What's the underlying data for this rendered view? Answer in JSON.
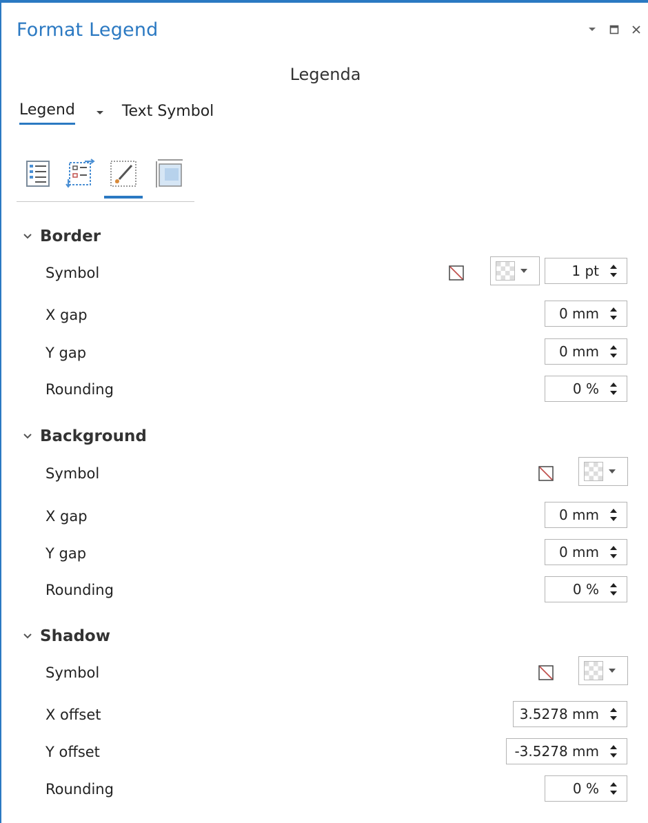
{
  "window": {
    "title": "Format Legend",
    "controls": [
      "chevron-down-icon",
      "maximize-icon",
      "close-icon"
    ]
  },
  "element_name": "Legenda",
  "tabs": [
    {
      "label": "Legend",
      "active": true
    },
    {
      "label": "Text Symbol",
      "active": false
    }
  ],
  "icon_tabs": [
    {
      "icon": "legend-items-icon",
      "active": false
    },
    {
      "icon": "arrangement-icon",
      "active": false
    },
    {
      "icon": "paintbrush-icon",
      "active": true
    },
    {
      "icon": "placement-icon",
      "active": false
    }
  ],
  "sections": {
    "border": {
      "header": "Border",
      "symbol_label": "Symbol",
      "width_value": "1 pt",
      "xgap_label": "X gap",
      "xgap_value": "0 mm",
      "ygap_label": "Y gap",
      "ygap_value": "0 mm",
      "rounding_label": "Rounding",
      "rounding_value": "0 %"
    },
    "background": {
      "header": "Background",
      "symbol_label": "Symbol",
      "xgap_label": "X gap",
      "xgap_value": "0 mm",
      "ygap_label": "Y gap",
      "ygap_value": "0 mm",
      "rounding_label": "Rounding",
      "rounding_value": "0 %"
    },
    "shadow": {
      "header": "Shadow",
      "symbol_label": "Symbol",
      "xoffset_label": "X offset",
      "xoffset_value": "3.5278 mm",
      "yoffset_label": "Y offset",
      "yoffset_value": "-3.5278 mm",
      "rounding_label": "Rounding",
      "rounding_value": "0 %"
    }
  },
  "colors": {
    "accent": "#2b79c2",
    "no_symbol_stroke": "#c0504d"
  }
}
